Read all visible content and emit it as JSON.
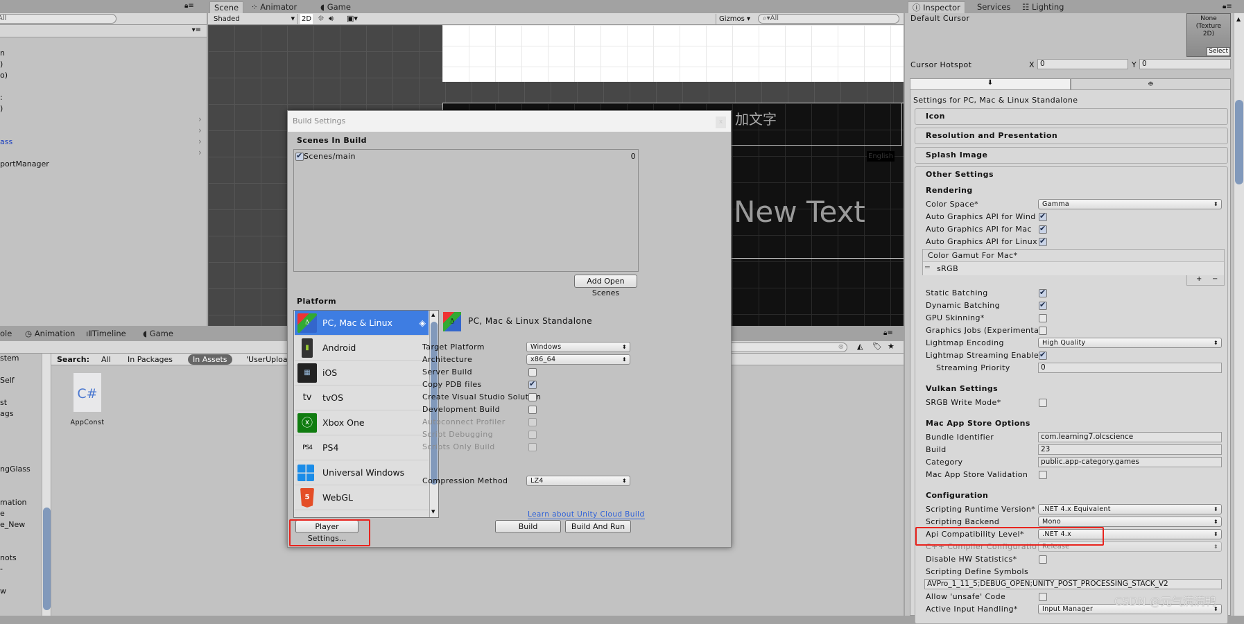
{
  "hierarchy": {
    "search_placeholder": "All",
    "items": [
      "n",
      ")",
      "o)",
      ":",
      ")",
      "",
      "",
      "ass",
      "",
      "portManager"
    ]
  },
  "scene_view": {
    "tabs": [
      "Scene",
      "Animator",
      "Game"
    ],
    "shading_mode": "Shaded",
    "mode_2d": "2D",
    "gizmos_label": "Gizmos",
    "search_placeholder": "All",
    "canvas_text_cn": "加文字",
    "canvas_text_new": "New Text",
    "canvas_small_label": "English"
  },
  "bottom_panel": {
    "tabs": [
      "ole",
      "Animation",
      "Timeline",
      "Game"
    ],
    "tree_items": [
      "stem",
      "Self",
      "st",
      "ags",
      "ngGlass",
      "mation",
      "e",
      "e_New",
      "nots",
      "-",
      "w"
    ],
    "search_label": "Search:",
    "search_scopes": [
      "All",
      "In Packages",
      "In Assets",
      "'UserUploa"
    ],
    "active_scope": "In Assets",
    "asset": {
      "name": "AppConst",
      "icon_text": "C#"
    }
  },
  "build_settings": {
    "title": "Build Settings",
    "close_label": "x",
    "scenes_header": "Scenes In Build",
    "scenes": [
      {
        "name": "Scenes/main",
        "index": "0",
        "checked": true
      }
    ],
    "add_open_scenes": "Add Open Scenes",
    "platform_header": "Platform",
    "platforms": [
      {
        "name": "PC, Mac & Linux Standalone",
        "icon": "standalone-icon",
        "selected": true
      },
      {
        "name": "Android",
        "icon": "android-icon"
      },
      {
        "name": "iOS",
        "icon": "ios-icon"
      },
      {
        "name": "tvOS",
        "icon": "tvos-icon",
        "icon_text": "tv"
      },
      {
        "name": "Xbox One",
        "icon": "xbox-icon"
      },
      {
        "name": "PS4",
        "icon": "ps4-icon",
        "icon_text": "PS4"
      },
      {
        "name": "Universal Windows Platform",
        "icon": "windows-icon"
      },
      {
        "name": "WebGL",
        "icon": "html5-icon",
        "icon_text": "5"
      }
    ],
    "selected_platform_title": "PC, Mac & Linux Standalone",
    "options": {
      "target_platform": {
        "label": "Target Platform",
        "value": "Windows"
      },
      "architecture": {
        "label": "Architecture",
        "value": "x86_64"
      },
      "server_build": {
        "label": "Server Build",
        "checked": false
      },
      "copy_pdb": {
        "label": "Copy PDB files",
        "checked": true
      },
      "vs_solution": {
        "label": "Create Visual Studio Solution",
        "checked": false
      },
      "development_build": {
        "label": "Development Build",
        "checked": false
      },
      "autoconnect_profiler": {
        "label": "Autoconnect Profiler",
        "checked": false,
        "disabled": true
      },
      "script_debugging": {
        "label": "Script Debugging",
        "checked": false,
        "disabled": true
      },
      "scripts_only": {
        "label": "Scripts Only Build",
        "checked": false,
        "disabled": true
      },
      "compression": {
        "label": "Compression Method",
        "value": "LZ4"
      }
    },
    "cloud_build_link": "Learn about Unity Cloud Build",
    "player_settings": "Player Settings...",
    "build": "Build",
    "build_and_run": "Build And Run"
  },
  "inspector": {
    "tabs": [
      "Inspector",
      "Services",
      "Lighting"
    ],
    "default_cursor_label": "Default Cursor",
    "cursor_texture": "None\n(Texture\n2D)",
    "select_label": "Select",
    "cursor_hotspot_label": "Cursor Hotspot",
    "hotspot_x_label": "X",
    "hotspot_x": "0",
    "hotspot_y_label": "Y",
    "hotspot_y": "0",
    "settings_for": "Settings for PC, Mac & Linux Standalone",
    "sections": [
      "Icon",
      "Resolution and Presentation",
      "Splash Image",
      "Other Settings"
    ],
    "rendering_header": "Rendering",
    "color_space": {
      "label": "Color Space*",
      "value": "Gamma"
    },
    "auto_gfx_win": {
      "label": "Auto Graphics API  for Wind",
      "checked": true
    },
    "auto_gfx_mac": {
      "label": "Auto Graphics API  for Mac",
      "checked": true
    },
    "auto_gfx_linux": {
      "label": "Auto Graphics API  for Linux",
      "checked": true
    },
    "color_gamut": {
      "label": "Color Gamut For Mac*",
      "item": "sRGB",
      "add": "+",
      "remove": "−"
    },
    "static_batching": {
      "label": "Static Batching",
      "checked": true
    },
    "dynamic_batching": {
      "label": "Dynamic Batching",
      "checked": true
    },
    "gpu_skinning": {
      "label": "GPU Skinning*",
      "checked": false
    },
    "graphics_jobs": {
      "label": "Graphics Jobs (Experimenta",
      "checked": false
    },
    "lightmap_encoding": {
      "label": "Lightmap Encoding",
      "value": "High Quality"
    },
    "lightmap_streaming": {
      "label": "Lightmap Streaming Enablec",
      "checked": true
    },
    "streaming_priority": {
      "label": "Streaming Priority",
      "value": "0"
    },
    "vulkan_header": "Vulkan Settings",
    "srgb_write": {
      "label": "SRGB Write Mode*",
      "checked": false
    },
    "mac_header": "Mac App Store Options",
    "bundle_id": {
      "label": "Bundle Identifier",
      "value": "com.learning7.olcscience"
    },
    "build": {
      "label": "Build",
      "value": "23"
    },
    "category": {
      "label": "Category",
      "value": "public.app-category.games"
    },
    "store_validation": {
      "label": "Mac App Store Validation",
      "checked": false
    },
    "config_header": "Configuration",
    "runtime_version": {
      "label": "Scripting Runtime Version*",
      "value": ".NET 4.x Equivalent"
    },
    "backend": {
      "label": "Scripting Backend",
      "value": "Mono"
    },
    "api_level": {
      "label": "Api Compatibility Level*",
      "value": ".NET 4.x"
    },
    "cpp_config": {
      "label": "C++ Compiler Configuration",
      "value": "Release"
    },
    "disable_hw": {
      "label": "Disable HW Statistics*",
      "checked": false
    },
    "define_symbols": {
      "label": "Scripting Define Symbols",
      "value": "AVPro_1_11_5;DEBUG_OPEN;UNITY_POST_PROCESSING_STACK_V2"
    },
    "unsafe_code": {
      "label": "Allow 'unsafe' Code",
      "checked": false
    },
    "input_handling": {
      "label": "Active Input Handling*",
      "value": "Input Manager"
    }
  },
  "watermark": "CSDN @元气满满鸭",
  "colors": {
    "selection": "#3e7de2",
    "highlight_box": "#e8241e",
    "link": "#2b5fd9"
  }
}
